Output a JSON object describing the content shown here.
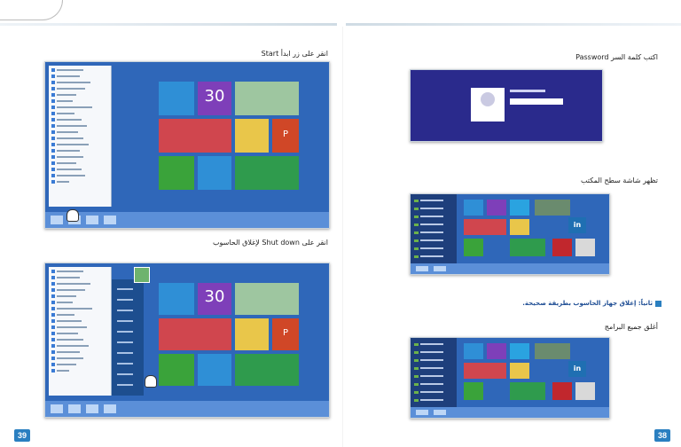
{
  "left_page": {
    "number": "39",
    "steps": [
      {
        "caption": "انقر على زر ابدأ Start"
      },
      {
        "caption": "انقر على Shut down لإغلاق الحاسوب"
      }
    ]
  },
  "right_page": {
    "number": "38",
    "steps": [
      {
        "caption": "اكتب كلمة السر Password"
      },
      {
        "caption": "تظهر شاشة سطح المكتب"
      }
    ],
    "section_heading": "ثانياً: إغلاق جهاز الحاسوب بطريقة صحيحة.",
    "step3": {
      "caption": "أغلق جميع البرامج"
    }
  },
  "tiles": {
    "weather_temp": "30",
    "tile_letters": [
      "P",
      "in"
    ]
  },
  "colors": {
    "accent": "#2a7fc0",
    "heading": "#1e4d94",
    "desktop_bg": "#2f67b9",
    "login_bg": "#2a2a8c"
  }
}
